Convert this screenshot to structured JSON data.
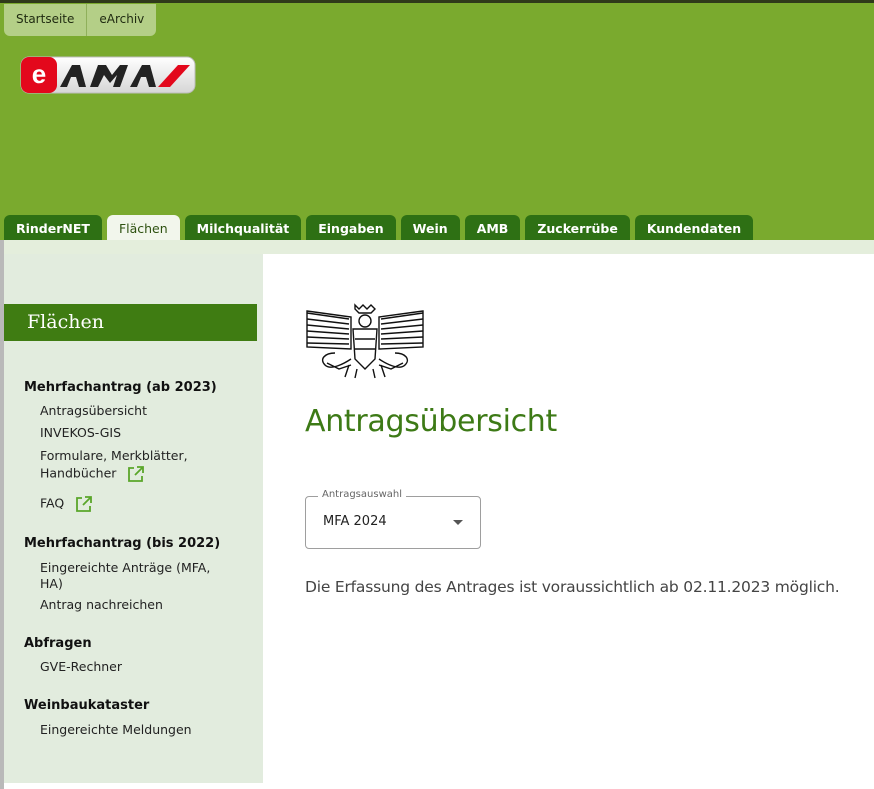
{
  "header": {
    "utility_tabs": [
      "Startseite",
      "eArchiv"
    ],
    "logo_text": "eAMA",
    "brand_color": "#7aaa2e"
  },
  "nav": {
    "tabs": [
      "RinderNET",
      "Flächen",
      "Milchqualität",
      "Eingaben",
      "Wein",
      "AMB",
      "Zuckerrübe",
      "Kundendaten"
    ],
    "active": "Flächen"
  },
  "sidebar": {
    "title": "Flächen",
    "groups": [
      {
        "title": "Mehrfachantrag (ab 2023)",
        "items": [
          "Antragsübersicht",
          "INVEKOS-GIS",
          "Formulare, Merkblätter, Handbücher",
          "FAQ"
        ]
      },
      {
        "title": "Mehrfachantrag (bis 2022)",
        "items": [
          "Eingereichte Anträge (MFA, HA)",
          "Antrag nachreichen"
        ]
      },
      {
        "title": "Abfragen",
        "items": [
          "GVE-Rechner"
        ]
      },
      {
        "title": "Weinbaukataster",
        "items": [
          "Eingereichte Meldungen"
        ]
      }
    ]
  },
  "main": {
    "title": "Antragsübersicht",
    "select": {
      "label": "Antragsauswahl",
      "value": "MFA 2024"
    },
    "info": "Die Erfassung des Antrages ist voraussichtlich ab 02.11.2023 möglich."
  }
}
